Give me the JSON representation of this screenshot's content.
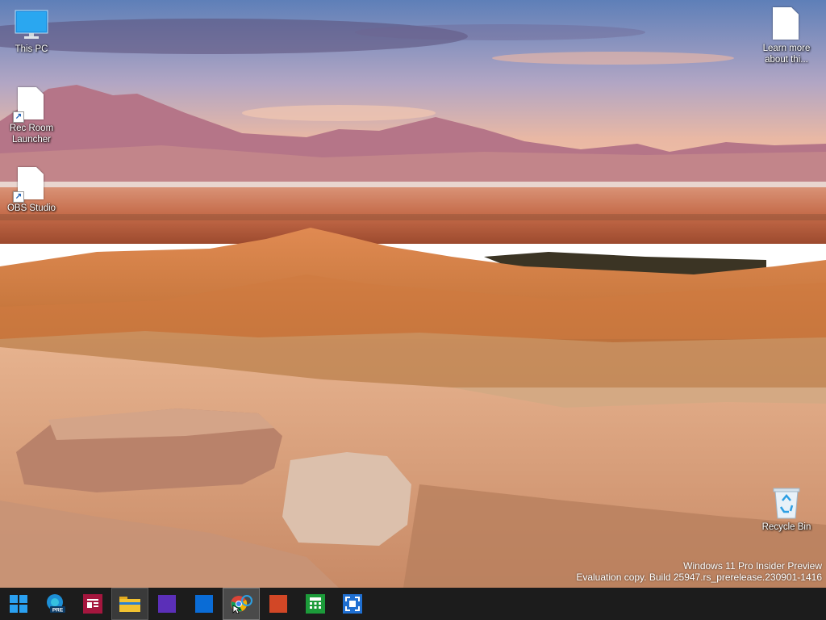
{
  "desktop": {
    "icons": [
      {
        "label": "This PC",
        "icon": "monitor-icon"
      },
      {
        "label": "Rec Room\nLauncher",
        "icon": "document-shortcut-icon"
      },
      {
        "label": "OBS Studio",
        "icon": "document-shortcut-icon"
      },
      {
        "label": "Learn more\nabout thi...",
        "icon": "document-icon"
      },
      {
        "label": "Recycle Bin",
        "icon": "recycle-bin-icon"
      }
    ]
  },
  "watermark": {
    "line1": "Windows 11 Pro Insider Preview",
    "line2": "Evaluation copy. Build 25947.rs_prerelease.230901-1416"
  },
  "taskbar": {
    "buttons": [
      {
        "icon": "windows-start-icon",
        "color": "#2aa0f0"
      },
      {
        "icon": "edge-preview-icon",
        "badge": "PRE",
        "color": "#1d8fd6"
      },
      {
        "icon": "reader-app-icon",
        "color": "#a5163e"
      },
      {
        "icon": "file-explorer-icon",
        "color": "#f2c231"
      },
      {
        "icon": "purple-app-icon",
        "color": "#5b2fb8"
      },
      {
        "icon": "blue-app-icon",
        "color": "#0a6cd6"
      },
      {
        "icon": "chrome-icon",
        "color": "#db4437"
      },
      {
        "icon": "orange-app-icon",
        "color": "#d24726"
      },
      {
        "icon": "calculator-icon",
        "color": "#1c9b3a"
      },
      {
        "icon": "screen-capture-icon",
        "color": "#1f6fd1"
      }
    ]
  }
}
